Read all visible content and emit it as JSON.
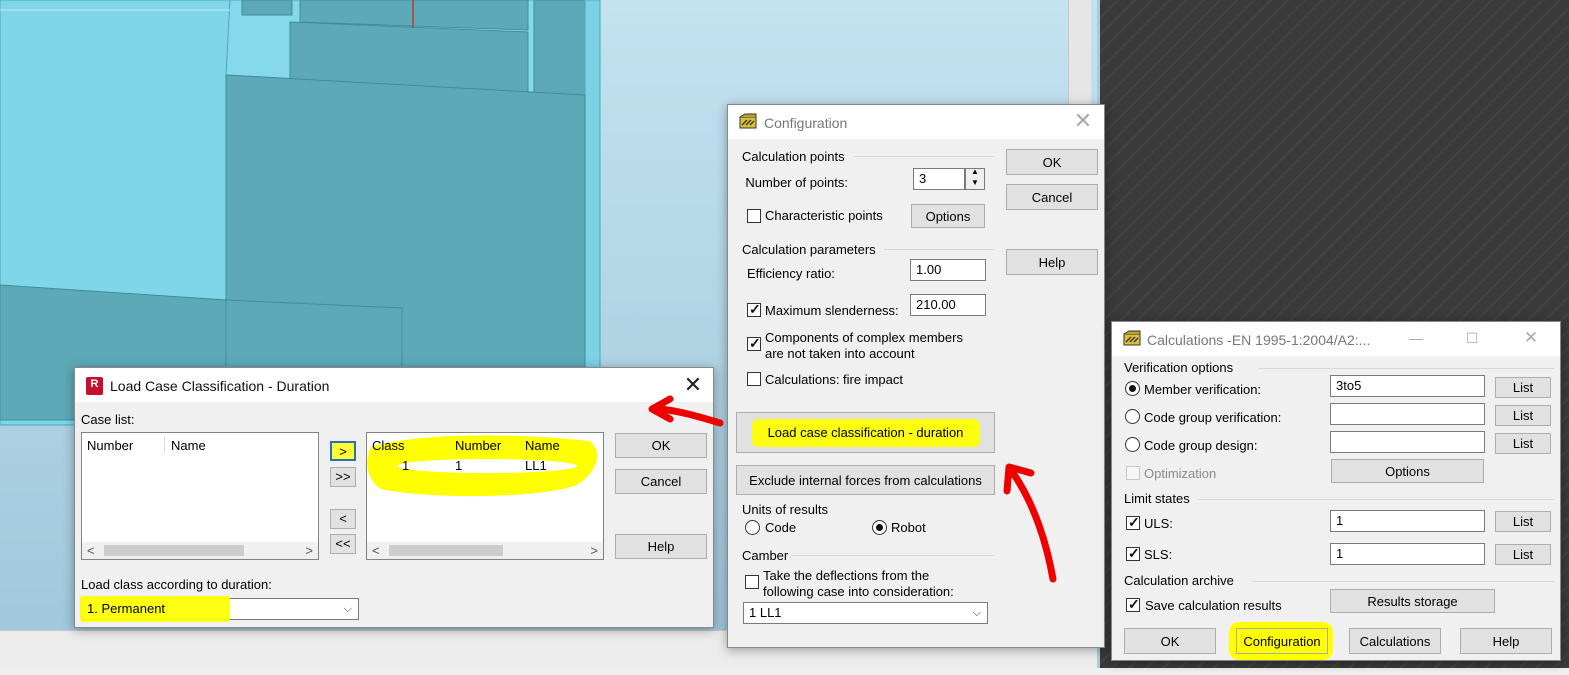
{
  "load_case_window": {
    "title": "Load Case Classification - Duration",
    "close_icon": "close-icon",
    "case_list_label": "Case list:",
    "left_list_headers": [
      "Number",
      "Name"
    ],
    "right_list_headers": [
      "Class",
      "Number",
      "Name"
    ],
    "right_list_rows": [
      {
        "class": "1",
        "number": "1",
        "name": "LL1"
      }
    ],
    "move_one_right": ">",
    "move_all_right": ">>",
    "move_one_left": "<",
    "move_all_left": "<<",
    "ok": "OK",
    "cancel": "Cancel",
    "help": "Help",
    "scroll_left": "<",
    "scroll_right": ">",
    "load_class_label": "Load class according to duration:",
    "load_class_value": "1. Permanent",
    "dropdown_icon": "⌵"
  },
  "config_window": {
    "title": "Configuration",
    "calc_points_group": "Calculation points",
    "number_of_points_label": "Number of points:",
    "number_of_points_value": "3",
    "characteristic_points_label": "Characteristic points",
    "options_button": "Options",
    "calc_params_group": "Calculation parameters",
    "efficiency_ratio_label": "Efficiency ratio:",
    "efficiency_ratio_value": "1.00",
    "max_slenderness_label": "Maximum slenderness:",
    "max_slenderness_value": "210.00",
    "complex_members_line1": "Components of complex members",
    "complex_members_line2": "are not taken into account",
    "fire_impact_label": "Calculations: fire impact",
    "load_case_duration_button": "Load case classification - duration",
    "exclude_forces_button": "Exclude internal forces from calculations",
    "units_group": "Units of results",
    "unit_code": "Code",
    "unit_robot": "Robot",
    "camber_group": "Camber",
    "camber_line1": "Take the deflections from the",
    "camber_line2": "following case into consideration:",
    "camber_case_value": "1  LL1",
    "ok": "OK",
    "cancel": "Cancel",
    "help": "Help"
  },
  "calc_window": {
    "title": "Calculations -EN 1995-1:2004/A2:...",
    "minimize_glyph": "—",
    "maximize_glyph": "☐",
    "close_glyph": "✕",
    "verification_group": "Verification options",
    "member_verification_label": "Member verification:",
    "member_verification_value": "3to5",
    "code_group_verification_label": "Code group verification:",
    "code_group_design_label": "Code group design:",
    "list_button": "List",
    "optimization_label": "Optimization",
    "options_button": "Options",
    "limit_states_group": "Limit states",
    "uls_label": "ULS:",
    "uls_value": "1",
    "sls_label": "SLS:",
    "sls_value": "1",
    "archive_group": "Calculation archive",
    "save_results_label": "Save calculation results",
    "results_storage_button": "Results storage",
    "ok": "OK",
    "configuration": "Configuration",
    "calculations": "Calculations",
    "help": "Help"
  },
  "colors": {
    "highlight": "#ffff00",
    "annotation_red": "#ee0000",
    "model_cyan": "#7dd8ea",
    "model_teal": "#5fa8b6"
  }
}
